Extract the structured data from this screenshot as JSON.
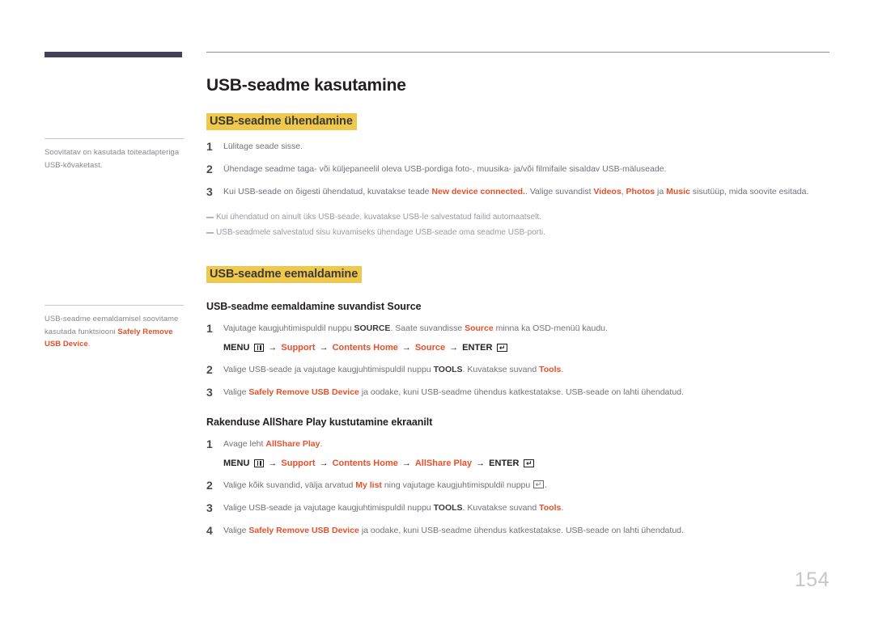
{
  "document": {
    "page_number": "154",
    "title": "USB-seadme kasutamine"
  },
  "colors": {
    "highlight": "#efc84e",
    "accent_orange": "#e8502a",
    "sidebar_bar": "#454059",
    "body_text": "#757079",
    "heading_text": "#231f20"
  },
  "sidebar": {
    "notes": [
      {
        "id": "note-power-adapter",
        "text_before": "Soovitatav on kasutada toiteadapteriga USB-kõvaketast.",
        "bold": "",
        "text_after": ""
      },
      {
        "id": "note-safely-remove",
        "text_before": "USB-seadme eemaldamisel soovitame kasutada funktsiooni ",
        "bold": "Safely Remove USB Device",
        "text_after": "."
      }
    ]
  },
  "sections": [
    {
      "id": "usb-connect",
      "heading": "USB-seadme ühendamine",
      "steps": [
        {
          "num": "1",
          "parts": [
            {
              "t": "Lülitage seade sisse.",
              "s": "plain"
            }
          ]
        },
        {
          "num": "2",
          "parts": [
            {
              "t": "Ühendage seadme taga- või küljepaneelil oleva USB-pordiga foto-, muusika- ja/või filmifaile sisaldav USB-mäluseade.",
              "s": "plain"
            }
          ]
        },
        {
          "num": "3",
          "parts": [
            {
              "t": "Kui USB-seade on õigesti ühendatud, kuvatakse teade ",
              "s": "plain"
            },
            {
              "t": "New device connected.",
              "s": "orange"
            },
            {
              "t": ". Valige suvandist ",
              "s": "plain"
            },
            {
              "t": "Videos",
              "s": "orange"
            },
            {
              "t": ", ",
              "s": "plain"
            },
            {
              "t": "Photos",
              "s": "orange"
            },
            {
              "t": " ja ",
              "s": "plain"
            },
            {
              "t": "Music",
              "s": "orange"
            },
            {
              "t": " sisutüüp, mida soovite esitada.",
              "s": "plain"
            }
          ]
        }
      ],
      "notes": [
        "Kui ühendatud on ainult üks USB-seade, kuvatakse USB-le salvestatud failid automaatselt.",
        "USB-seadmele salvestatud sisu kuvamiseks ühendage USB-seade oma seadme USB-porti."
      ]
    }
  ],
  "removal_section": {
    "heading": "USB-seadme eemaldamine",
    "subsections": [
      {
        "id": "removal-from-source",
        "title": "USB-seadme eemaldamine suvandist Source",
        "steps": [
          {
            "num": "1",
            "parts": [
              {
                "t": "Vajutage kaugjuhtimispuldil nuppu ",
                "s": "plain"
              },
              {
                "t": "SOURCE",
                "s": "bold"
              },
              {
                "t": ". Saate suvandisse ",
                "s": "plain"
              },
              {
                "t": "Source",
                "s": "orange"
              },
              {
                "t": " minna ka OSD-menüü kaudu.",
                "s": "plain"
              }
            ],
            "path": {
              "menu_label": "MENU",
              "menu_icon": "menu-grid-icon",
              "crumbs": [
                "Support",
                "Contents Home",
                "Source"
              ],
              "enter_label": "ENTER",
              "enter_icon": "enter-key-icon",
              "arrow": "→"
            }
          },
          {
            "num": "2",
            "parts": [
              {
                "t": "Valige USB-seade ja vajutage kaugjuhtimispuldil nuppu ",
                "s": "plain"
              },
              {
                "t": "TOOLS",
                "s": "bold"
              },
              {
                "t": ". Kuvatakse suvand ",
                "s": "plain"
              },
              {
                "t": "Tools",
                "s": "orange"
              },
              {
                "t": ".",
                "s": "plain"
              }
            ]
          },
          {
            "num": "3",
            "parts": [
              {
                "t": "Valige ",
                "s": "plain"
              },
              {
                "t": "Safely Remove USB Device",
                "s": "orange"
              },
              {
                "t": " ja oodake, kuni USB-seadme ühendus katkestatakse. USB-seade on lahti ühendatud.",
                "s": "plain"
              }
            ]
          }
        ]
      },
      {
        "id": "removal-allshare-play",
        "title": "Rakenduse AllShare Play kustutamine ekraanilt",
        "steps": [
          {
            "num": "1",
            "parts": [
              {
                "t": "Avage leht ",
                "s": "plain"
              },
              {
                "t": "AllShare Play",
                "s": "orange"
              },
              {
                "t": ".",
                "s": "plain"
              }
            ],
            "path": {
              "menu_label": "MENU",
              "menu_icon": "menu-grid-icon",
              "crumbs": [
                "Support",
                "Contents Home",
                "AllShare Play"
              ],
              "enter_label": "ENTER",
              "enter_icon": "enter-key-icon",
              "arrow": "→"
            }
          },
          {
            "num": "2",
            "parts": [
              {
                "t": "Valige kõik suvandid, välja arvatud ",
                "s": "plain"
              },
              {
                "t": "My list",
                "s": "orange"
              },
              {
                "t": " ning vajutage kaugjuhtimispuldil nuppu ",
                "s": "plain"
              },
              {
                "t": "",
                "s": "enter-icon"
              },
              {
                "t": ".",
                "s": "plain"
              }
            ]
          },
          {
            "num": "3",
            "parts": [
              {
                "t": "Valige USB-seade ja vajutage kaugjuhtimispuldil nuppu ",
                "s": "plain"
              },
              {
                "t": "TOOLS",
                "s": "bold"
              },
              {
                "t": ". Kuvatakse suvand ",
                "s": "plain"
              },
              {
                "t": "Tools",
                "s": "orange"
              },
              {
                "t": ".",
                "s": "plain"
              }
            ]
          },
          {
            "num": "4",
            "parts": [
              {
                "t": "Valige ",
                "s": "plain"
              },
              {
                "t": "Safely Remove USB Device",
                "s": "orange"
              },
              {
                "t": " ja oodake, kuni USB-seadme ühendus katkestatakse. USB-seade on lahti ühendatud.",
                "s": "plain"
              }
            ]
          }
        ]
      }
    ]
  }
}
